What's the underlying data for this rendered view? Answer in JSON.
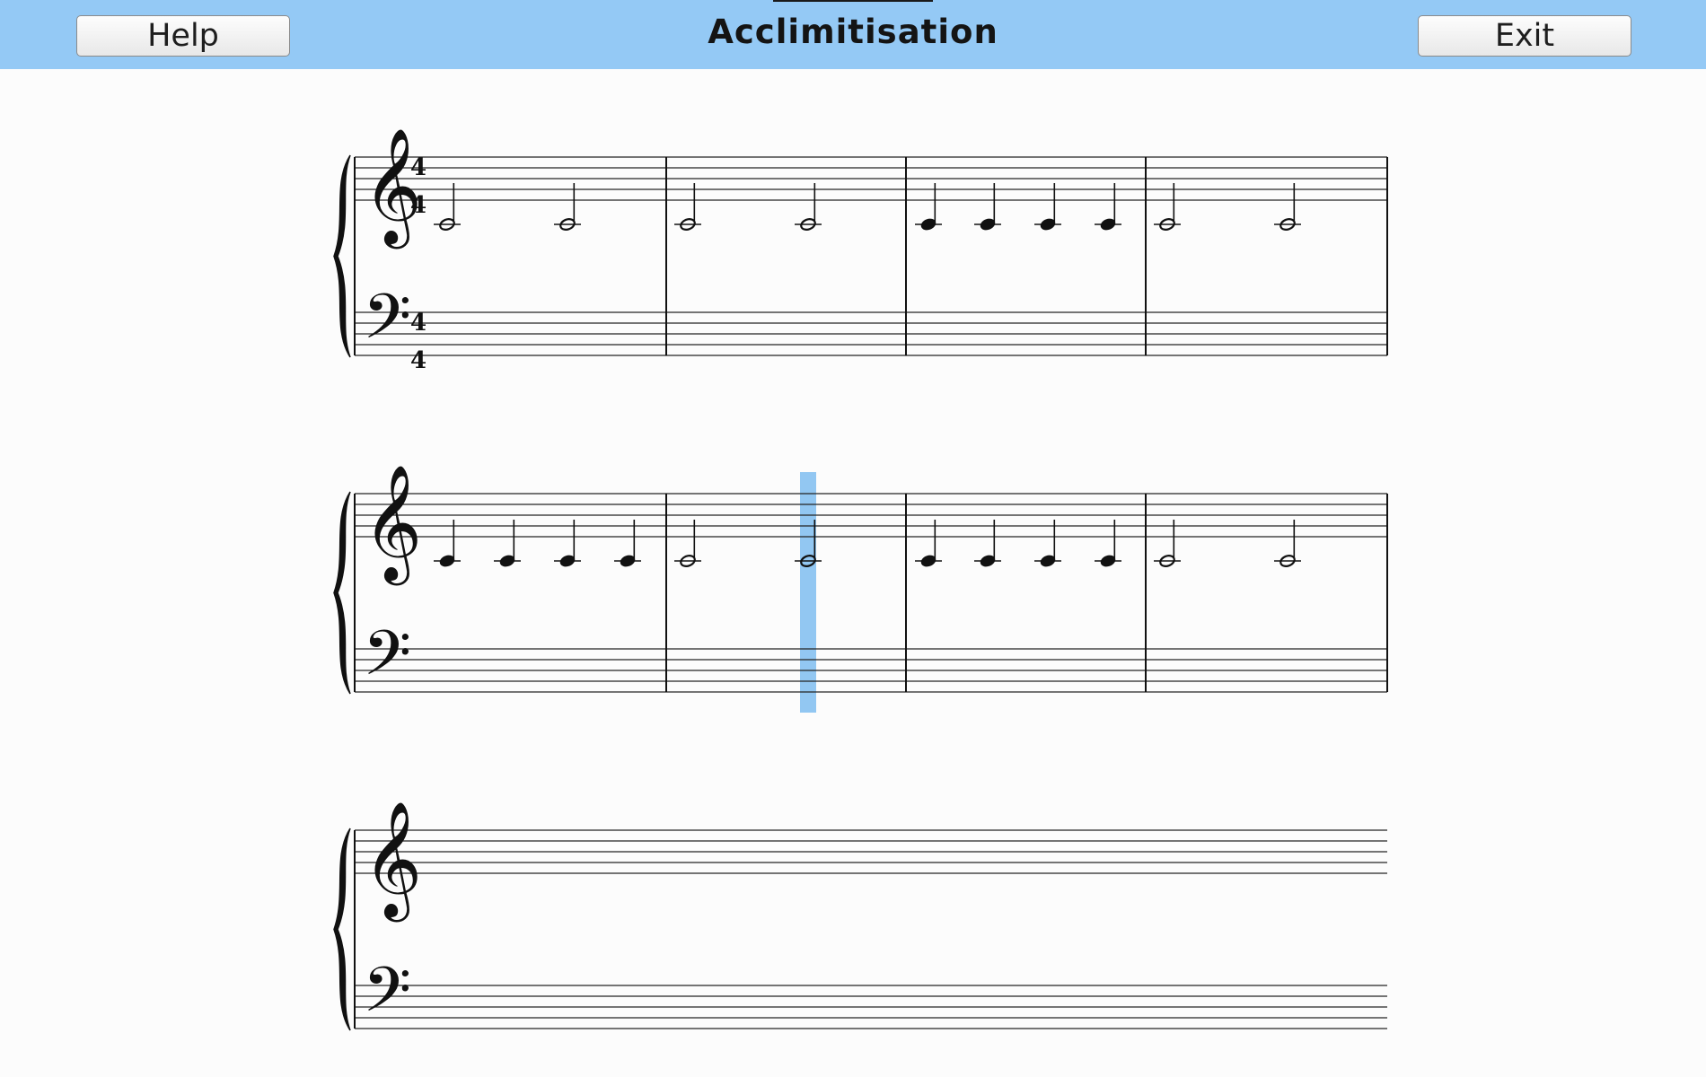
{
  "header": {
    "title": "Acclimitisation",
    "help_label": "Help",
    "exit_label": "Exit",
    "background_color": "#94c9f5"
  },
  "score": {
    "time_signature": {
      "numerator": "4",
      "denominator": "4"
    },
    "playhead_color": "#7fbdf0",
    "playhead": {
      "system": 2,
      "measure": 2,
      "beat": 3
    },
    "systems": [
      {
        "measures": [
          [
            {
              "beat": 1,
              "value": "half"
            },
            {
              "beat": 3,
              "value": "half"
            }
          ],
          [
            {
              "beat": 1,
              "value": "half"
            },
            {
              "beat": 3,
              "value": "half"
            }
          ],
          [
            {
              "beat": 1,
              "value": "quarter"
            },
            {
              "beat": 2,
              "value": "quarter"
            },
            {
              "beat": 3,
              "value": "quarter"
            },
            {
              "beat": 4,
              "value": "quarter"
            }
          ],
          [
            {
              "beat": 1,
              "value": "half"
            },
            {
              "beat": 3,
              "value": "half"
            }
          ]
        ]
      },
      {
        "measures": [
          [
            {
              "beat": 1,
              "value": "quarter"
            },
            {
              "beat": 2,
              "value": "quarter"
            },
            {
              "beat": 3,
              "value": "quarter"
            },
            {
              "beat": 4,
              "value": "quarter"
            }
          ],
          [
            {
              "beat": 1,
              "value": "half"
            },
            {
              "beat": 3,
              "value": "half"
            }
          ],
          [
            {
              "beat": 1,
              "value": "quarter"
            },
            {
              "beat": 2,
              "value": "quarter"
            },
            {
              "beat": 3,
              "value": "quarter"
            },
            {
              "beat": 4,
              "value": "quarter"
            }
          ],
          [
            {
              "beat": 1,
              "value": "half"
            },
            {
              "beat": 3,
              "value": "half"
            }
          ]
        ]
      },
      {
        "measures": []
      }
    ]
  }
}
